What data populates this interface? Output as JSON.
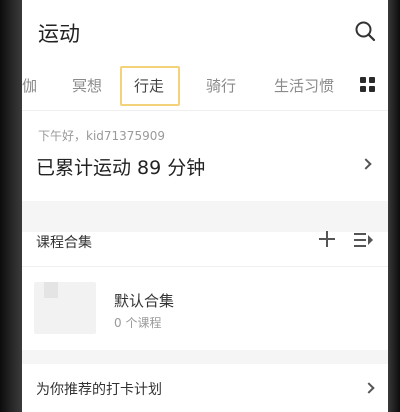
{
  "header": {
    "title": "运动",
    "search_icon": "search-icon"
  },
  "tabs": [
    {
      "label": "伽",
      "active": false
    },
    {
      "label": "冥想",
      "active": false
    },
    {
      "label": "行走",
      "active": true
    },
    {
      "label": "骑行",
      "active": false
    },
    {
      "label": "生活习惯",
      "active": false
    }
  ],
  "tabs_more_icon": "grid-icon",
  "summary": {
    "greeting": "下午好，kid71375909",
    "total": "已累计运动 89 分钟"
  },
  "courses": {
    "title": "课程合集",
    "add_icon": "plus-icon",
    "sort_icon": "sort-icon",
    "collection": {
      "title": "默认合集",
      "count": "0 个课程"
    }
  },
  "plan": {
    "title": "为你推荐的打卡计划"
  },
  "colors": {
    "tab_highlight": "#f4d27a",
    "text_primary": "#222222",
    "text_secondary": "#9a9a9a"
  }
}
